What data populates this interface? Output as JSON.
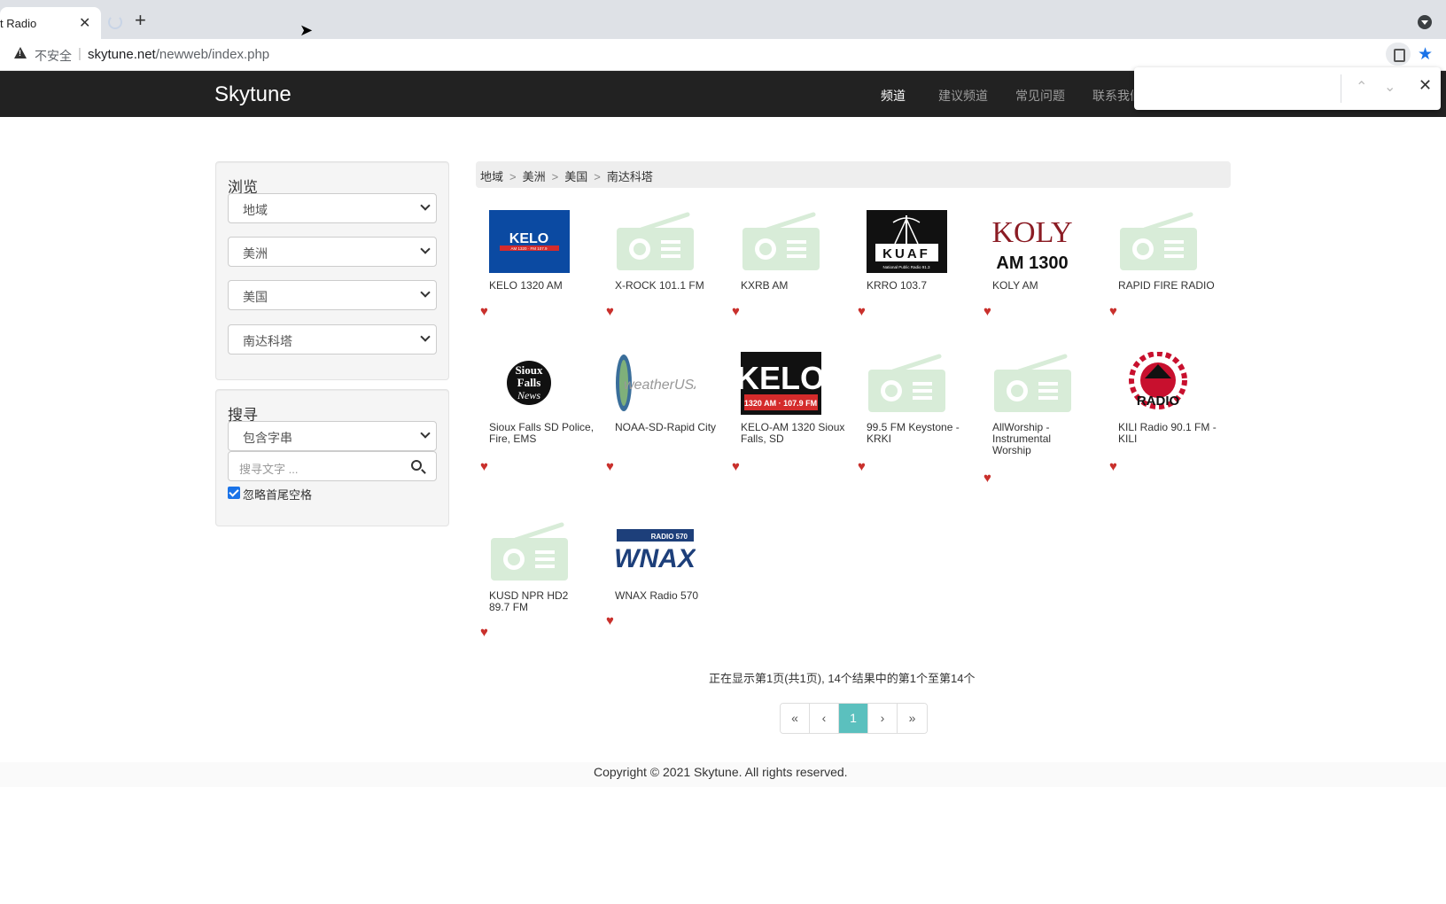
{
  "browser": {
    "tab_title": "t Radio",
    "tab_close": "✕",
    "new_tab": "+",
    "insecure_label": "不安全",
    "separator": "|",
    "url_host": "skytune.net",
    "url_path": "/newweb/index.php"
  },
  "navbar": {
    "brand": "Skytune",
    "items": [
      "频道",
      "建议频道",
      "常见问题",
      "联系我们"
    ]
  },
  "find": {
    "value": "",
    "prev": "⌃",
    "next": "⌄",
    "close": "✕"
  },
  "sidebar": {
    "browse_title": "浏览",
    "selects": [
      "地域",
      "美洲",
      "美国",
      "南达科塔"
    ],
    "search_title": "搜寻",
    "search_mode": "包含字串",
    "search_placeholder": "搜寻文字 ...",
    "ignore_spaces_label": "忽略首尾空格",
    "ignore_spaces_checked": true
  },
  "breadcrumb": [
    "地域",
    "美洲",
    "美国",
    "南达科塔"
  ],
  "stations": [
    {
      "name": "KELO 1320 AM",
      "logo": "kelo-small"
    },
    {
      "name": "X-ROCK 101.1 FM",
      "logo": "radio-placeholder"
    },
    {
      "name": "KXRB AM",
      "logo": "radio-placeholder"
    },
    {
      "name": "KRRO 103.7",
      "logo": "kuaf"
    },
    {
      "name": "KOLY AM",
      "logo": "koly"
    },
    {
      "name": "RAPID FIRE RADIO",
      "logo": "radio-placeholder"
    },
    {
      "name": "Sioux Falls SD Police, Fire, EMS",
      "logo": "sioux-falls-news"
    },
    {
      "name": "NOAA-SD-Rapid City",
      "logo": "weather-usa"
    },
    {
      "name": "KELO-AM 1320 Sioux Falls, SD",
      "logo": "kelo-large"
    },
    {
      "name": "99.5 FM Keystone - KRKI",
      "logo": "radio-placeholder"
    },
    {
      "name": "AllWorship - Instrumental Worship",
      "logo": "radio-placeholder"
    },
    {
      "name": "KILI Radio 90.1 FM - KILI",
      "logo": "kili"
    },
    {
      "name": "KUSD NPR HD2 89.7 FM",
      "logo": "radio-placeholder"
    },
    {
      "name": "WNAX Radio 570",
      "logo": "wnax"
    }
  ],
  "logo_text": {
    "kelo_small": "KELO",
    "kelo_small_sub": "AM 1320 · FM 107.9",
    "kuaf": "KUAF",
    "kuaf_sub": "National Public Radio 91.3",
    "koly_top": "KOLY",
    "koly_bottom": "AM 1300",
    "sioux_1": "Sioux",
    "sioux_2": "Falls",
    "sioux_3": "News",
    "weather": "weatherUSA",
    "kelo_large": "KELO",
    "kelo_large_sub": "1320 AM · 107.9 FM",
    "kili": "RADIO",
    "wnax": "WNAX",
    "wnax_sub": "RADIO 570"
  },
  "pagination": {
    "info": "正在显示第1页(共1页), 14个结果中的第1个至第14个",
    "first": "«",
    "prev": "‹",
    "current": "1",
    "next": "›",
    "last": "»"
  },
  "footer": {
    "copyright": "Copyright © 2021 Skytune. All rights reserved."
  },
  "colors": {
    "navbar_bg": "#222222",
    "active_page": "#5bc0be",
    "heart": "#c9302c",
    "placeholder_logo": "#d8ecd8"
  },
  "icons": {
    "favorite": "heart-icon",
    "search": "search-icon",
    "warning": "warning-icon",
    "star": "star-icon"
  }
}
